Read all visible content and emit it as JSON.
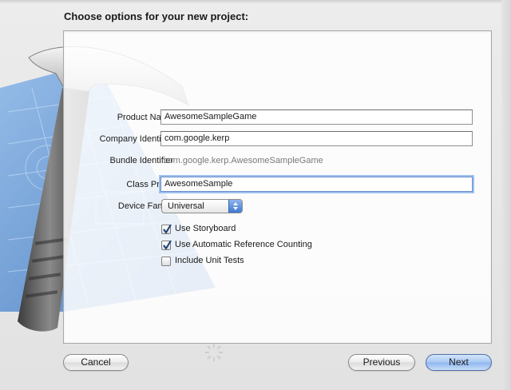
{
  "dialog": {
    "title": "Choose options for your new project:"
  },
  "form": {
    "product_name": {
      "label": "Product Name",
      "value": "AwesomeSampleGame"
    },
    "company_identifier": {
      "label": "Company Identifier",
      "value": "com.google.kerp"
    },
    "bundle_identifier": {
      "label": "Bundle Identifier",
      "value": "com.google.kerp.AwesomeSampleGame"
    },
    "class_prefix": {
      "label": "Class Prefix",
      "value": "AwesomeSample"
    },
    "device_family": {
      "label": "Device Family",
      "selected": "Universal"
    },
    "checkboxes": [
      {
        "label": "Use Storyboard",
        "checked": true
      },
      {
        "label": "Use Automatic Reference Counting",
        "checked": true
      },
      {
        "label": "Include Unit Tests",
        "checked": false
      }
    ]
  },
  "buttons": {
    "cancel": "Cancel",
    "previous": "Previous",
    "next": "Next"
  },
  "icons": {
    "background_art": "xcode-hammer-blueprint-icon",
    "select_arrows": "up-down-arrows-icon",
    "checkmark": "checkmark-icon",
    "progress": "spinner-gear-icon"
  },
  "colors": {
    "focus_ring": "#9ec0ee",
    "default_button": "#8db6ef",
    "blueprint": "#4f86c9",
    "hammer_handle": "#5a5a5a"
  }
}
